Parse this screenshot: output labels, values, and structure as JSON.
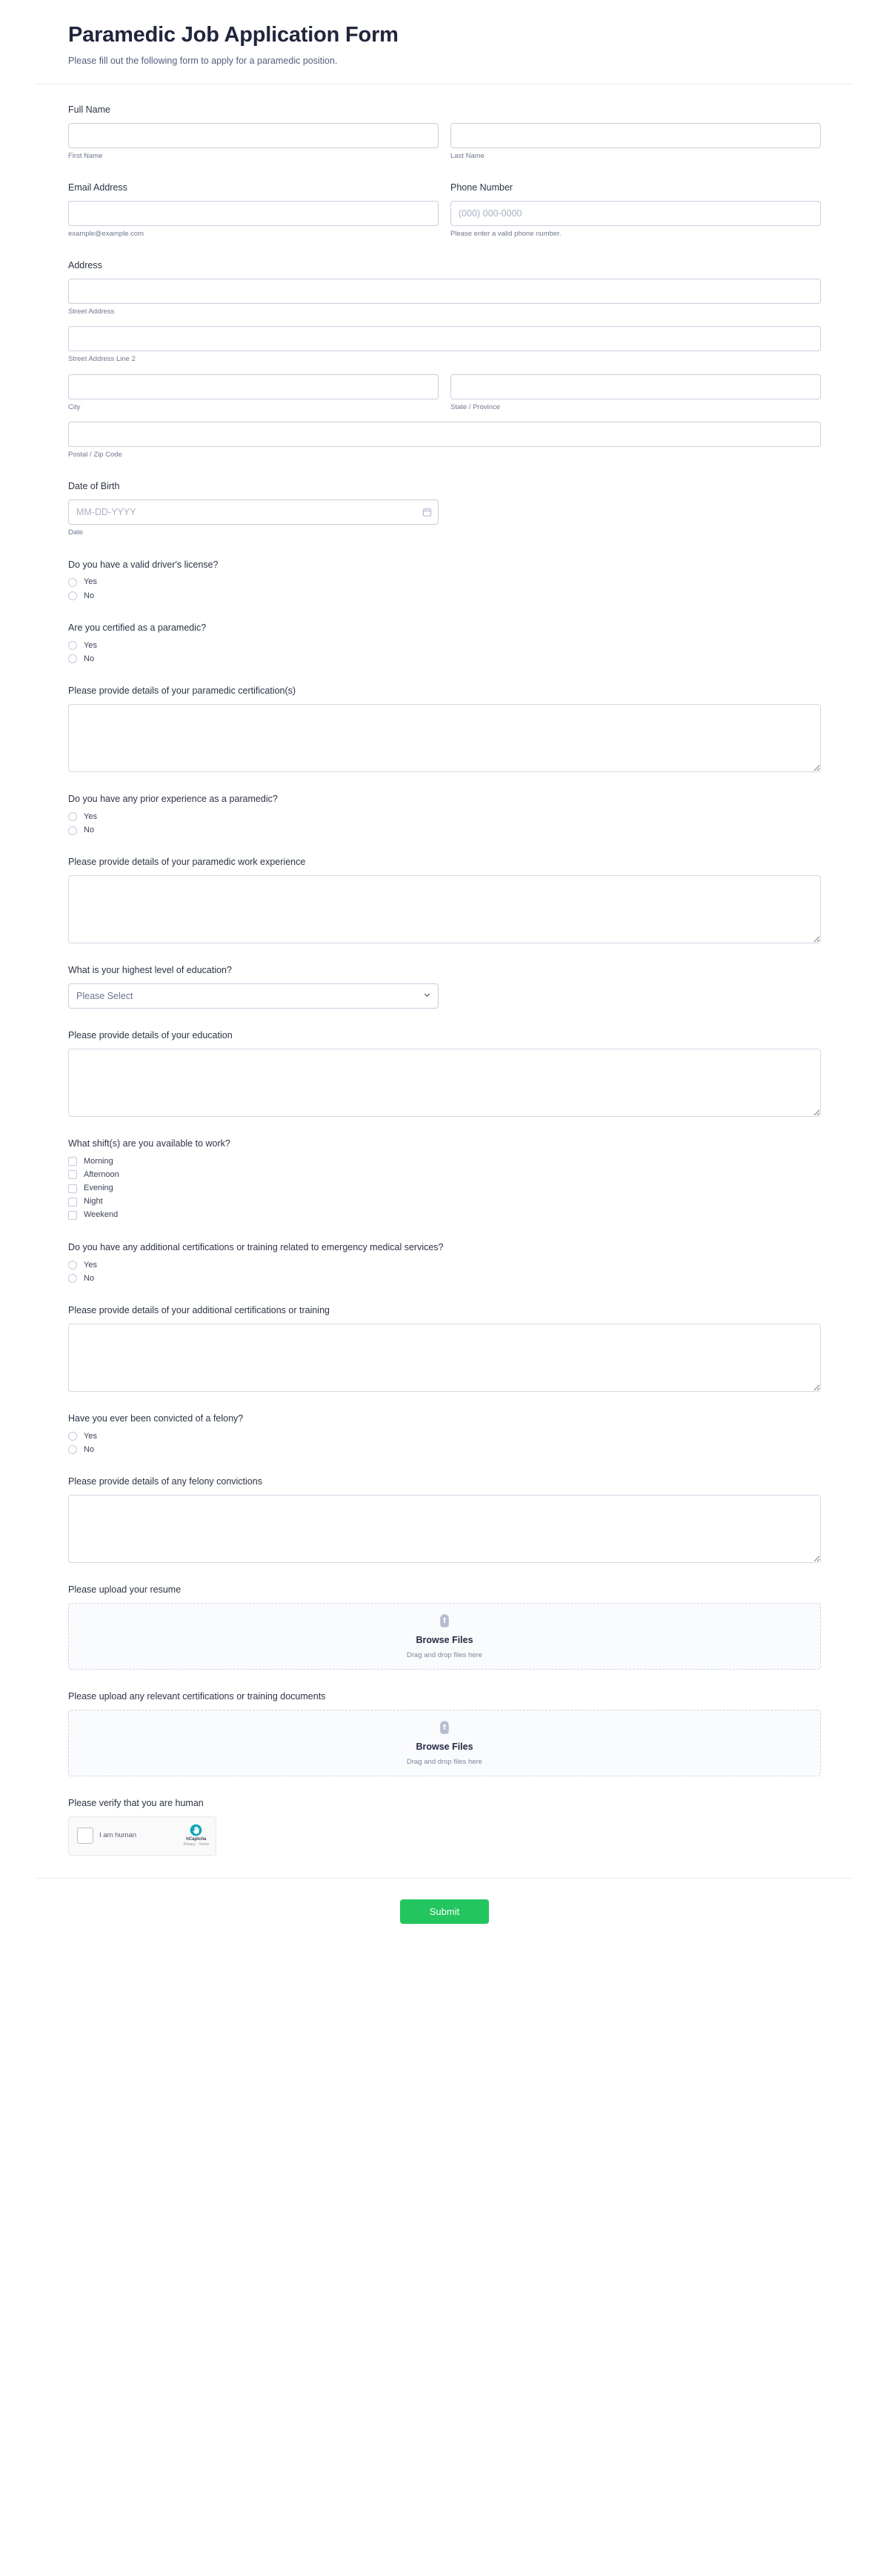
{
  "header": {
    "title": "Paramedic Job Application Form",
    "subtitle": "Please fill out the following form to apply for a paramedic position."
  },
  "fields": {
    "full_name": {
      "label": "Full Name",
      "first_sublabel": "First Name",
      "last_sublabel": "Last Name",
      "first_value": "",
      "last_value": "",
      "first_placeholder": "",
      "last_placeholder": ""
    },
    "email": {
      "label": "Email Address",
      "sublabel": "example@example.com",
      "value": "",
      "placeholder": ""
    },
    "phone": {
      "label": "Phone Number",
      "sublabel": "Please enter a valid phone number.",
      "value": "",
      "placeholder": "(000) 000-0000"
    },
    "address": {
      "label": "Address",
      "street_sublabel": "Street Address",
      "street2_sublabel": "Street Address Line 2",
      "city_sublabel": "City",
      "state_sublabel": "State / Province",
      "postal_sublabel": "Postal / Zip Code",
      "street_value": "",
      "street2_value": "",
      "city_value": "",
      "state_value": "",
      "postal_value": ""
    },
    "dob": {
      "label": "Date of Birth",
      "sublabel": "Date",
      "placeholder": "MM-DD-YYYY",
      "value": ""
    },
    "drivers_license": {
      "label": "Do you have a valid driver's license?",
      "options": [
        "Yes",
        "No"
      ]
    },
    "certified_paramedic": {
      "label": "Are you certified as a paramedic?",
      "options": [
        "Yes",
        "No"
      ]
    },
    "certification_details": {
      "label": "Please provide details of your paramedic certification(s)",
      "value": ""
    },
    "prior_experience": {
      "label": "Do you have any prior experience as a paramedic?",
      "options": [
        "Yes",
        "No"
      ]
    },
    "work_experience_details": {
      "label": "Please provide details of your paramedic work experience",
      "value": ""
    },
    "education_level": {
      "label": "What is your highest level of education?",
      "selected": "Please Select",
      "options": [
        "Please Select"
      ]
    },
    "education_details": {
      "label": "Please provide details of your education",
      "value": ""
    },
    "shifts": {
      "label": "What shift(s) are you available to work?",
      "options": [
        "Morning",
        "Afternoon",
        "Evening",
        "Night",
        "Weekend"
      ]
    },
    "additional_certifications": {
      "label": "Do you have any additional certifications or training related to emergency medical services?",
      "options": [
        "Yes",
        "No"
      ]
    },
    "additional_certification_details": {
      "label": "Please provide details of your additional certifications or training",
      "value": ""
    },
    "felony": {
      "label": "Have you ever been convicted of a felony?",
      "options": [
        "Yes",
        "No"
      ]
    },
    "felony_details": {
      "label": "Please provide details of any felony convictions",
      "value": ""
    },
    "resume_upload": {
      "label": "Please upload your resume",
      "browse_label": "Browse Files",
      "drop_hint": "Drag and drop files here"
    },
    "certifications_upload": {
      "label": "Please upload any relevant certifications or training documents",
      "browse_label": "Browse Files",
      "drop_hint": "Drag and drop files here"
    },
    "captcha": {
      "label": "Please verify that you are human",
      "checkbox_label": "I am human",
      "brand": "hCaptcha",
      "links": "Privacy - Terms"
    }
  },
  "footer": {
    "submit_label": "Submit"
  },
  "colors": {
    "submit_green": "#22c55e",
    "title_dark": "#20263b",
    "hcaptcha_teal": "#0aa5b8"
  }
}
